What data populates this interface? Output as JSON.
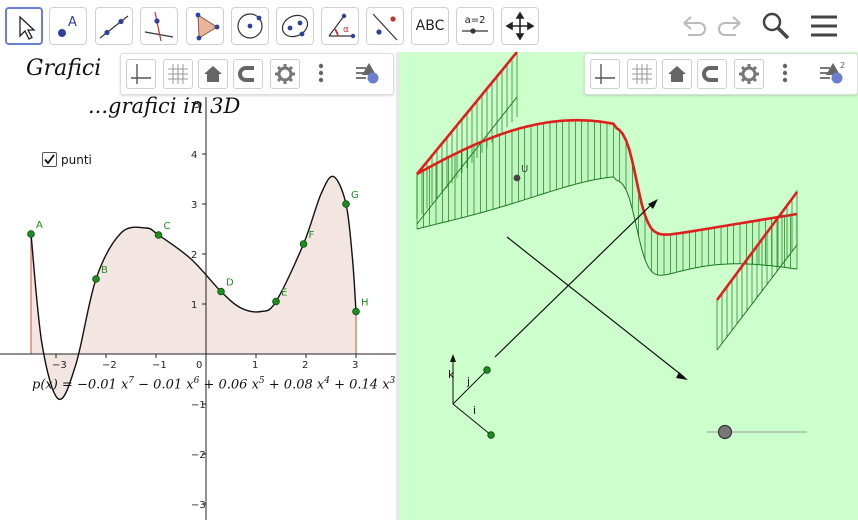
{
  "toolbar": {
    "tools": [
      "move-tool",
      "point-tool",
      "line-tool",
      "perpendicular-line-tool",
      "polygon-tool",
      "circle-center-point-tool",
      "conic-tool",
      "angle-tool",
      "reflect-tool",
      "text-tool",
      "slider-tool",
      "move-graphics-view-tool"
    ],
    "text_tool_label": "ABC",
    "slider_tool_label": "a=2"
  },
  "graphics_view": {
    "title_line1": "Grafici",
    "title_line2": "...grafici in 3D",
    "checkbox_label": "punti",
    "checkbox_checked": true,
    "formula_prefix": "p(x) = ",
    "formula_terms": [
      "−0.01 x",
      "7",
      " − 0.01 x",
      "6",
      " + 0.06 x",
      "5",
      " + 0.08 x",
      "4",
      " + 0.14 x",
      "3"
    ],
    "x_ticks": [
      "−3",
      "−2",
      "−1",
      "0",
      "1",
      "2",
      "3"
    ],
    "y_ticks": [
      "4",
      "3",
      "2",
      "1",
      "−1",
      "−2",
      "−3"
    ],
    "y_top_tick": "5",
    "points": [
      {
        "label": "A",
        "x": -3.5,
        "y": 2.4
      },
      {
        "label": "B",
        "x": -2.2,
        "y": 1.5
      },
      {
        "label": "C",
        "x": -0.95,
        "y": 2.38
      },
      {
        "label": "D",
        "x": 0.3,
        "y": 1.25
      },
      {
        "label": "E",
        "x": 1.4,
        "y": 1.05
      },
      {
        "label": "F",
        "x": 1.95,
        "y": 2.2
      },
      {
        "label": "G",
        "x": 2.8,
        "y": 3.0
      },
      {
        "label": "H",
        "x": 3.0,
        "y": 0.85
      }
    ]
  },
  "view3d": {
    "point_label": "U",
    "axis_labels": {
      "k": "k",
      "j": "j",
      "i": "i"
    },
    "top_tick": "2"
  },
  "colors": {
    "point_green": "#1e8c1e",
    "curve_red": "#e01e1e",
    "surface_green": "#1a7a1a",
    "fill_area": "#f3e6e2",
    "bg_3d": "#ccffcc"
  }
}
